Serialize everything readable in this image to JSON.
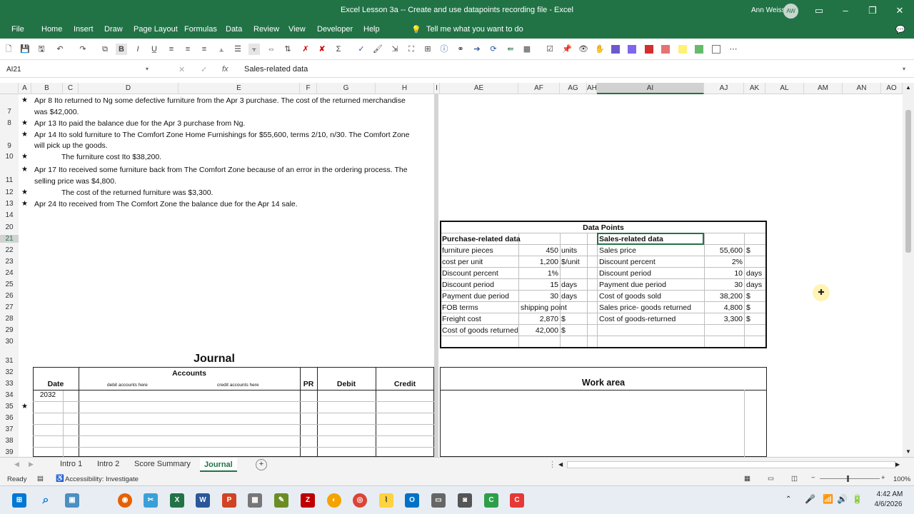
{
  "window": {
    "title": "Excel Lesson 3a -- Create and use datapoints recording file  -  Excel",
    "user": "Ann Weiss",
    "avatar": "AW"
  },
  "menu": {
    "tabs": [
      "File",
      "Home",
      "Insert",
      "Draw",
      "Page Layout",
      "Formulas",
      "Data",
      "Review",
      "View",
      "Developer",
      "Help"
    ],
    "tell_me": "Tell me what you want to do"
  },
  "formula_bar": {
    "name_box": "AI21",
    "formula": "Sales-related data",
    "fx": "fx"
  },
  "columns": {
    "left": [
      "A",
      "B",
      "C",
      "D",
      "E",
      "F",
      "G",
      "H",
      "I"
    ],
    "right": [
      "AE",
      "AF",
      "AG",
      "AH",
      "AI",
      "AJ",
      "AK",
      "AL",
      "AM",
      "AN",
      "AO"
    ]
  },
  "rows": [
    "7",
    "8",
    "9",
    "10",
    "11",
    "12",
    "13",
    "14",
    "20",
    "21",
    "22",
    "23",
    "24",
    "25",
    "26",
    "27",
    "28",
    "29",
    "30",
    "31",
    "32",
    "33",
    "34",
    "35",
    "36",
    "37",
    "38",
    "39"
  ],
  "transactions": [
    {
      "star": "★",
      "line1": "Apr 8  Ito returned to Ng some defective furniture from the Apr 3 purchase.  The cost of the returned merchandise",
      "line2": "was  $42,000."
    },
    {
      "star": "★",
      "line1": "Apr 13  Ito paid the balance due for the Apr 3 purchase from Ng."
    },
    {
      "star": "★",
      "line1": "Apr 14  Ito sold furniture to The Comfort Zone Home Furnishings for $55,600, terms 2/10, n/30.  The Comfort Zone",
      "line2": "will pick up the goods."
    },
    {
      "star": "★",
      "line1": "The furniture cost Ito $38,200."
    },
    {
      "star": "★",
      "line1": "Apr 17  Ito received some furniture back from The Comfort Zone because of an error in the ordering process.  The",
      "line2": "selling price was $4,800."
    },
    {
      "star": "★",
      "line1": "The cost of the returned furniture was $3,300."
    },
    {
      "star": "★",
      "line1": "Apr 24  Ito received from The Comfort Zone the balance due for the Apr 14 sale."
    }
  ],
  "datapoints": {
    "title": "Data Points",
    "purchase_header": "Purchase-related data",
    "sales_header": "Sales-related data",
    "purchase": [
      {
        "label": "furniture pieces",
        "value": "450",
        "unit": "units"
      },
      {
        "label": "cost per unit",
        "value": "1,200",
        "unit": "$/unit"
      },
      {
        "label": "Discount percent",
        "value": "1%",
        "unit": ""
      },
      {
        "label": "Discount period",
        "value": "15",
        "unit": "days"
      },
      {
        "label": "Payment due period",
        "value": "30",
        "unit": "days"
      },
      {
        "label": "FOB terms",
        "value": "shipping point",
        "unit": ""
      },
      {
        "label": "Freight cost",
        "value": "2,870",
        "unit": "$"
      },
      {
        "label": "Cost of goods returned",
        "value": "42,000",
        "unit": "$"
      }
    ],
    "sales": [
      {
        "label": "Sales price",
        "value": "55,600",
        "unit": "$"
      },
      {
        "label": "Discount percent",
        "value": "2%",
        "unit": ""
      },
      {
        "label": "Discount period",
        "value": "10",
        "unit": "days"
      },
      {
        "label": "Payment due period",
        "value": "30",
        "unit": "days"
      },
      {
        "label": "Cost of goods sold",
        "value": "38,200",
        "unit": "$"
      },
      {
        "label": "Sales price- goods returned",
        "value": "4,800",
        "unit": "$"
      },
      {
        "label": "Cost of goods-returned",
        "value": "3,300",
        "unit": "$"
      }
    ]
  },
  "journal": {
    "title": "Journal",
    "accounts": "Accounts",
    "date": "Date",
    "debit_hint": "debit accounts here",
    "credit_hint": "credit accounts here",
    "pr": "PR",
    "debit": "Debit",
    "credit": "Credit",
    "year": "2032",
    "row_star": "★"
  },
  "work_area": {
    "title": "Work area"
  },
  "sheets": [
    "Intro 1",
    "Intro 2",
    "Score Summary",
    "Journal"
  ],
  "active_sheet": "Journal",
  "status": {
    "ready": "Ready",
    "accessibility": "Accessibility: Investigate",
    "zoom": "100%"
  },
  "taskbar": {
    "time": "4:42 AM",
    "date": "4/6/2026"
  },
  "colors": {
    "excel_green": "#217346"
  }
}
